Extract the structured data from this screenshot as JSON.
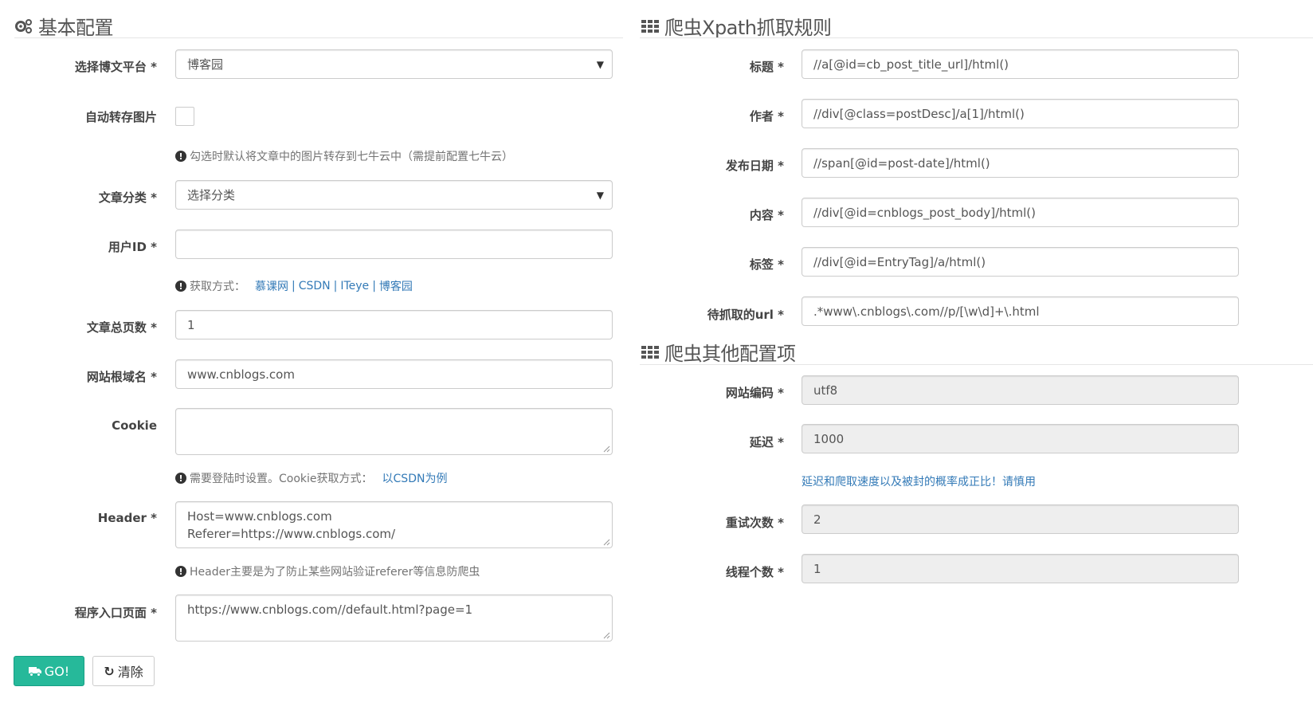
{
  "left": {
    "title": "基本配置",
    "fields": {
      "platform": {
        "label": "选择博文平台 *",
        "value": "博客园"
      },
      "autosave": {
        "label": "自动转存图片",
        "help": "勾选时默认将文章中的图片转存到七牛云中（需提前配置七牛云）"
      },
      "category": {
        "label": "文章分类 *",
        "value": "选择分类"
      },
      "userid": {
        "label": "用户ID *",
        "value": ""
      },
      "userid_help": {
        "prefix": "获取方式：",
        "links": [
          "慕课网",
          "CSDN",
          "ITeye",
          "博客园"
        ],
        "separator": "|"
      },
      "pages": {
        "label": "文章总页数 *",
        "value": "1"
      },
      "domain": {
        "label": "网站根域名 *",
        "value": "www.cnblogs.com"
      },
      "cookie": {
        "label": "Cookie",
        "value": ""
      },
      "cookie_help": {
        "text": "需要登陆时设置。Cookie获取方式：",
        "link": "以CSDN为例"
      },
      "header": {
        "label": "Header *",
        "value": "Host=www.cnblogs.com\nReferer=https://www.cnblogs.com/"
      },
      "header_help": "Header主要是为了防止某些网站验证referer等信息防爬虫",
      "entry": {
        "label": "程序入口页面 *",
        "value": "https://www.cnblogs.com//default.html?page=1"
      }
    },
    "buttons": {
      "go": "GO!",
      "clear": "清除"
    }
  },
  "right": {
    "title_xpath": "爬虫Xpath抓取规则",
    "xpath": {
      "title": {
        "label": "标题 *",
        "value": "//a[@id=cb_post_title_url]/html()"
      },
      "author": {
        "label": "作者 *",
        "value": "//div[@class=postDesc]/a[1]/html()"
      },
      "date": {
        "label": "发布日期 *",
        "value": "//span[@id=post-date]/html()"
      },
      "content": {
        "label": "内容 *",
        "value": "//div[@id=cnblogs_post_body]/html()"
      },
      "tags": {
        "label": "标签 *",
        "value": "//div[@id=EntryTag]/a/html()"
      },
      "url": {
        "label": "待抓取的url *",
        "value": ".*www\\.cnblogs\\.com//p/[\\w\\d]+\\.html"
      }
    },
    "title_other": "爬虫其他配置项",
    "other": {
      "encoding": {
        "label": "网站编码 *",
        "value": "utf8"
      },
      "delay": {
        "label": "延迟 *",
        "value": "1000"
      },
      "delay_help": "延迟和爬取速度以及被封的概率成正比！请慎用",
      "retry": {
        "label": "重试次数 *",
        "value": "2"
      },
      "threads": {
        "label": "线程个数 *",
        "value": "1"
      }
    }
  },
  "icons": {
    "cogs": "cogs-icon",
    "grid": "grid-icon",
    "info": "info-circle-icon",
    "truck": "truck-icon",
    "refresh": "refresh-icon",
    "caret": "caret-down-icon"
  },
  "colors": {
    "primary": "#26b99a",
    "link": "#337ab7",
    "readonly_bg": "#eeeeee"
  }
}
